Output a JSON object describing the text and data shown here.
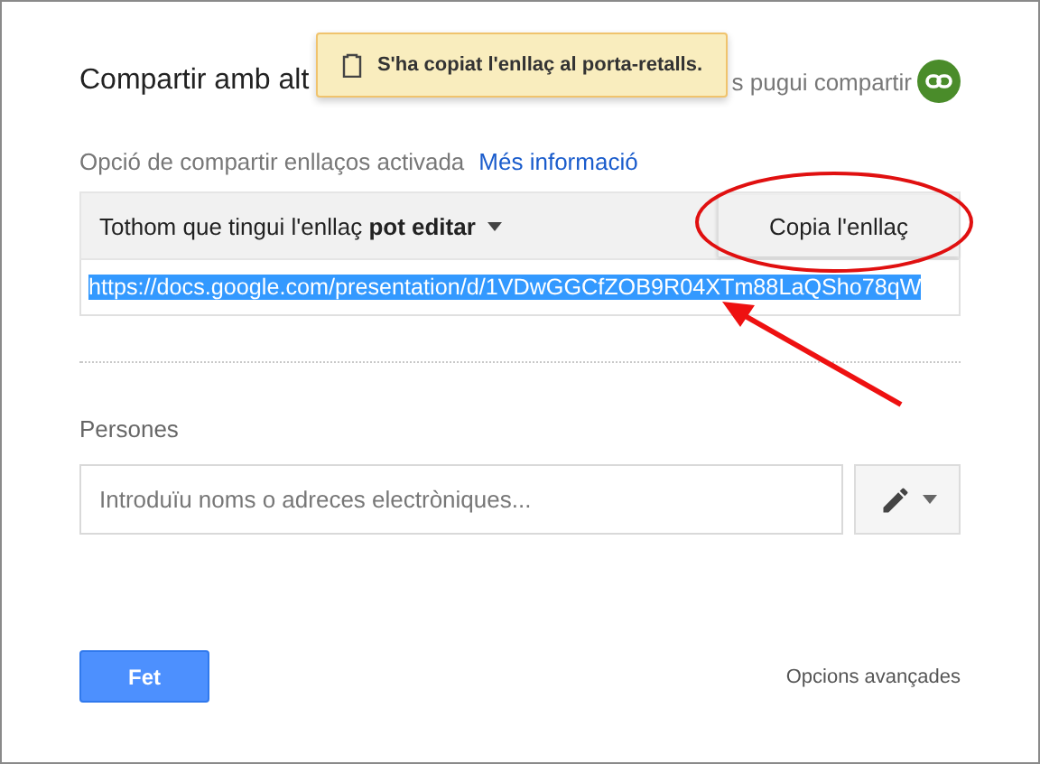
{
  "dialog": {
    "title": "Compartir amb alt",
    "hint": "s pugui compartir"
  },
  "toast": {
    "message": "S'ha copiat l'enllaç al porta-retalls."
  },
  "link_sharing": {
    "status": "Opció de compartir enllaços activada",
    "more_info": "Més informació",
    "access": "Tothom que tingui l'enllaç **pot editar**",
    "copy_button": "Copia l'enllaç",
    "url": "https://docs.google.com/presentation/d/1VDwGGCfZOB9R04XTm88LaQSho78qW",
    "url_selected": true
  },
  "people": {
    "label": "Persones",
    "placeholder": "Introduïu noms o adreces electròniques..."
  },
  "footer": {
    "done_button": "Fet",
    "advanced": "Opcions avançades"
  }
}
